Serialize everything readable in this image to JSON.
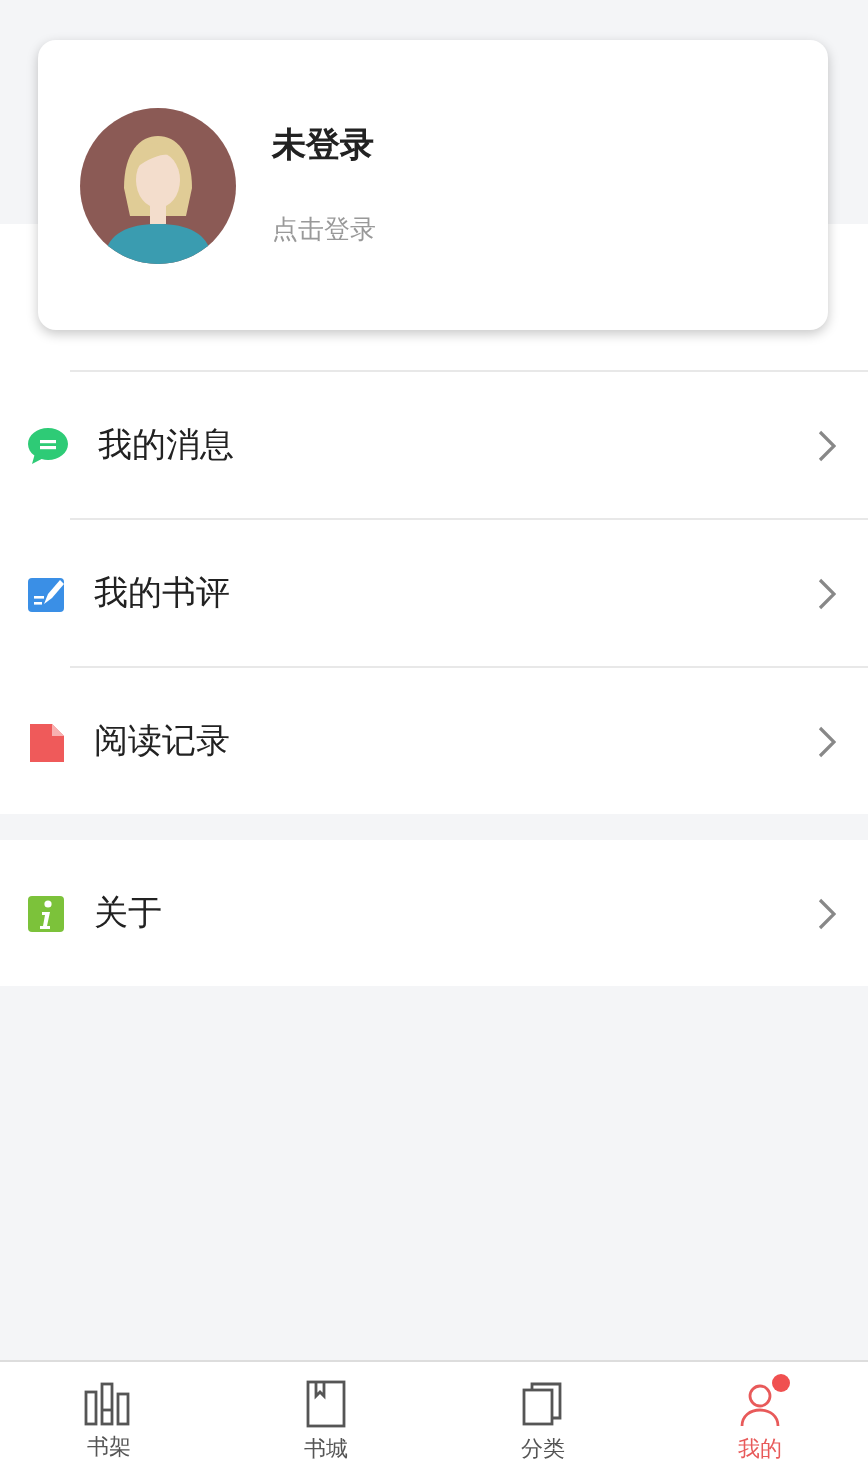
{
  "profile": {
    "name": "未登录",
    "hint": "点击登录"
  },
  "menu_groups": [
    [
      {
        "label": "我的消息",
        "kind": "message"
      },
      {
        "label": "我的书评",
        "kind": "review"
      },
      {
        "label": "阅读记录",
        "kind": "history"
      }
    ],
    [
      {
        "label": "关于",
        "kind": "about"
      }
    ]
  ],
  "tab_bar": [
    {
      "label": "书架",
      "kind": "shelf",
      "selected": false,
      "badge": false
    },
    {
      "label": "书城",
      "kind": "store",
      "selected": false,
      "badge": false
    },
    {
      "label": "分类",
      "kind": "category",
      "selected": false,
      "badge": false
    },
    {
      "label": "我的",
      "kind": "me",
      "selected": true,
      "badge": true
    }
  ]
}
